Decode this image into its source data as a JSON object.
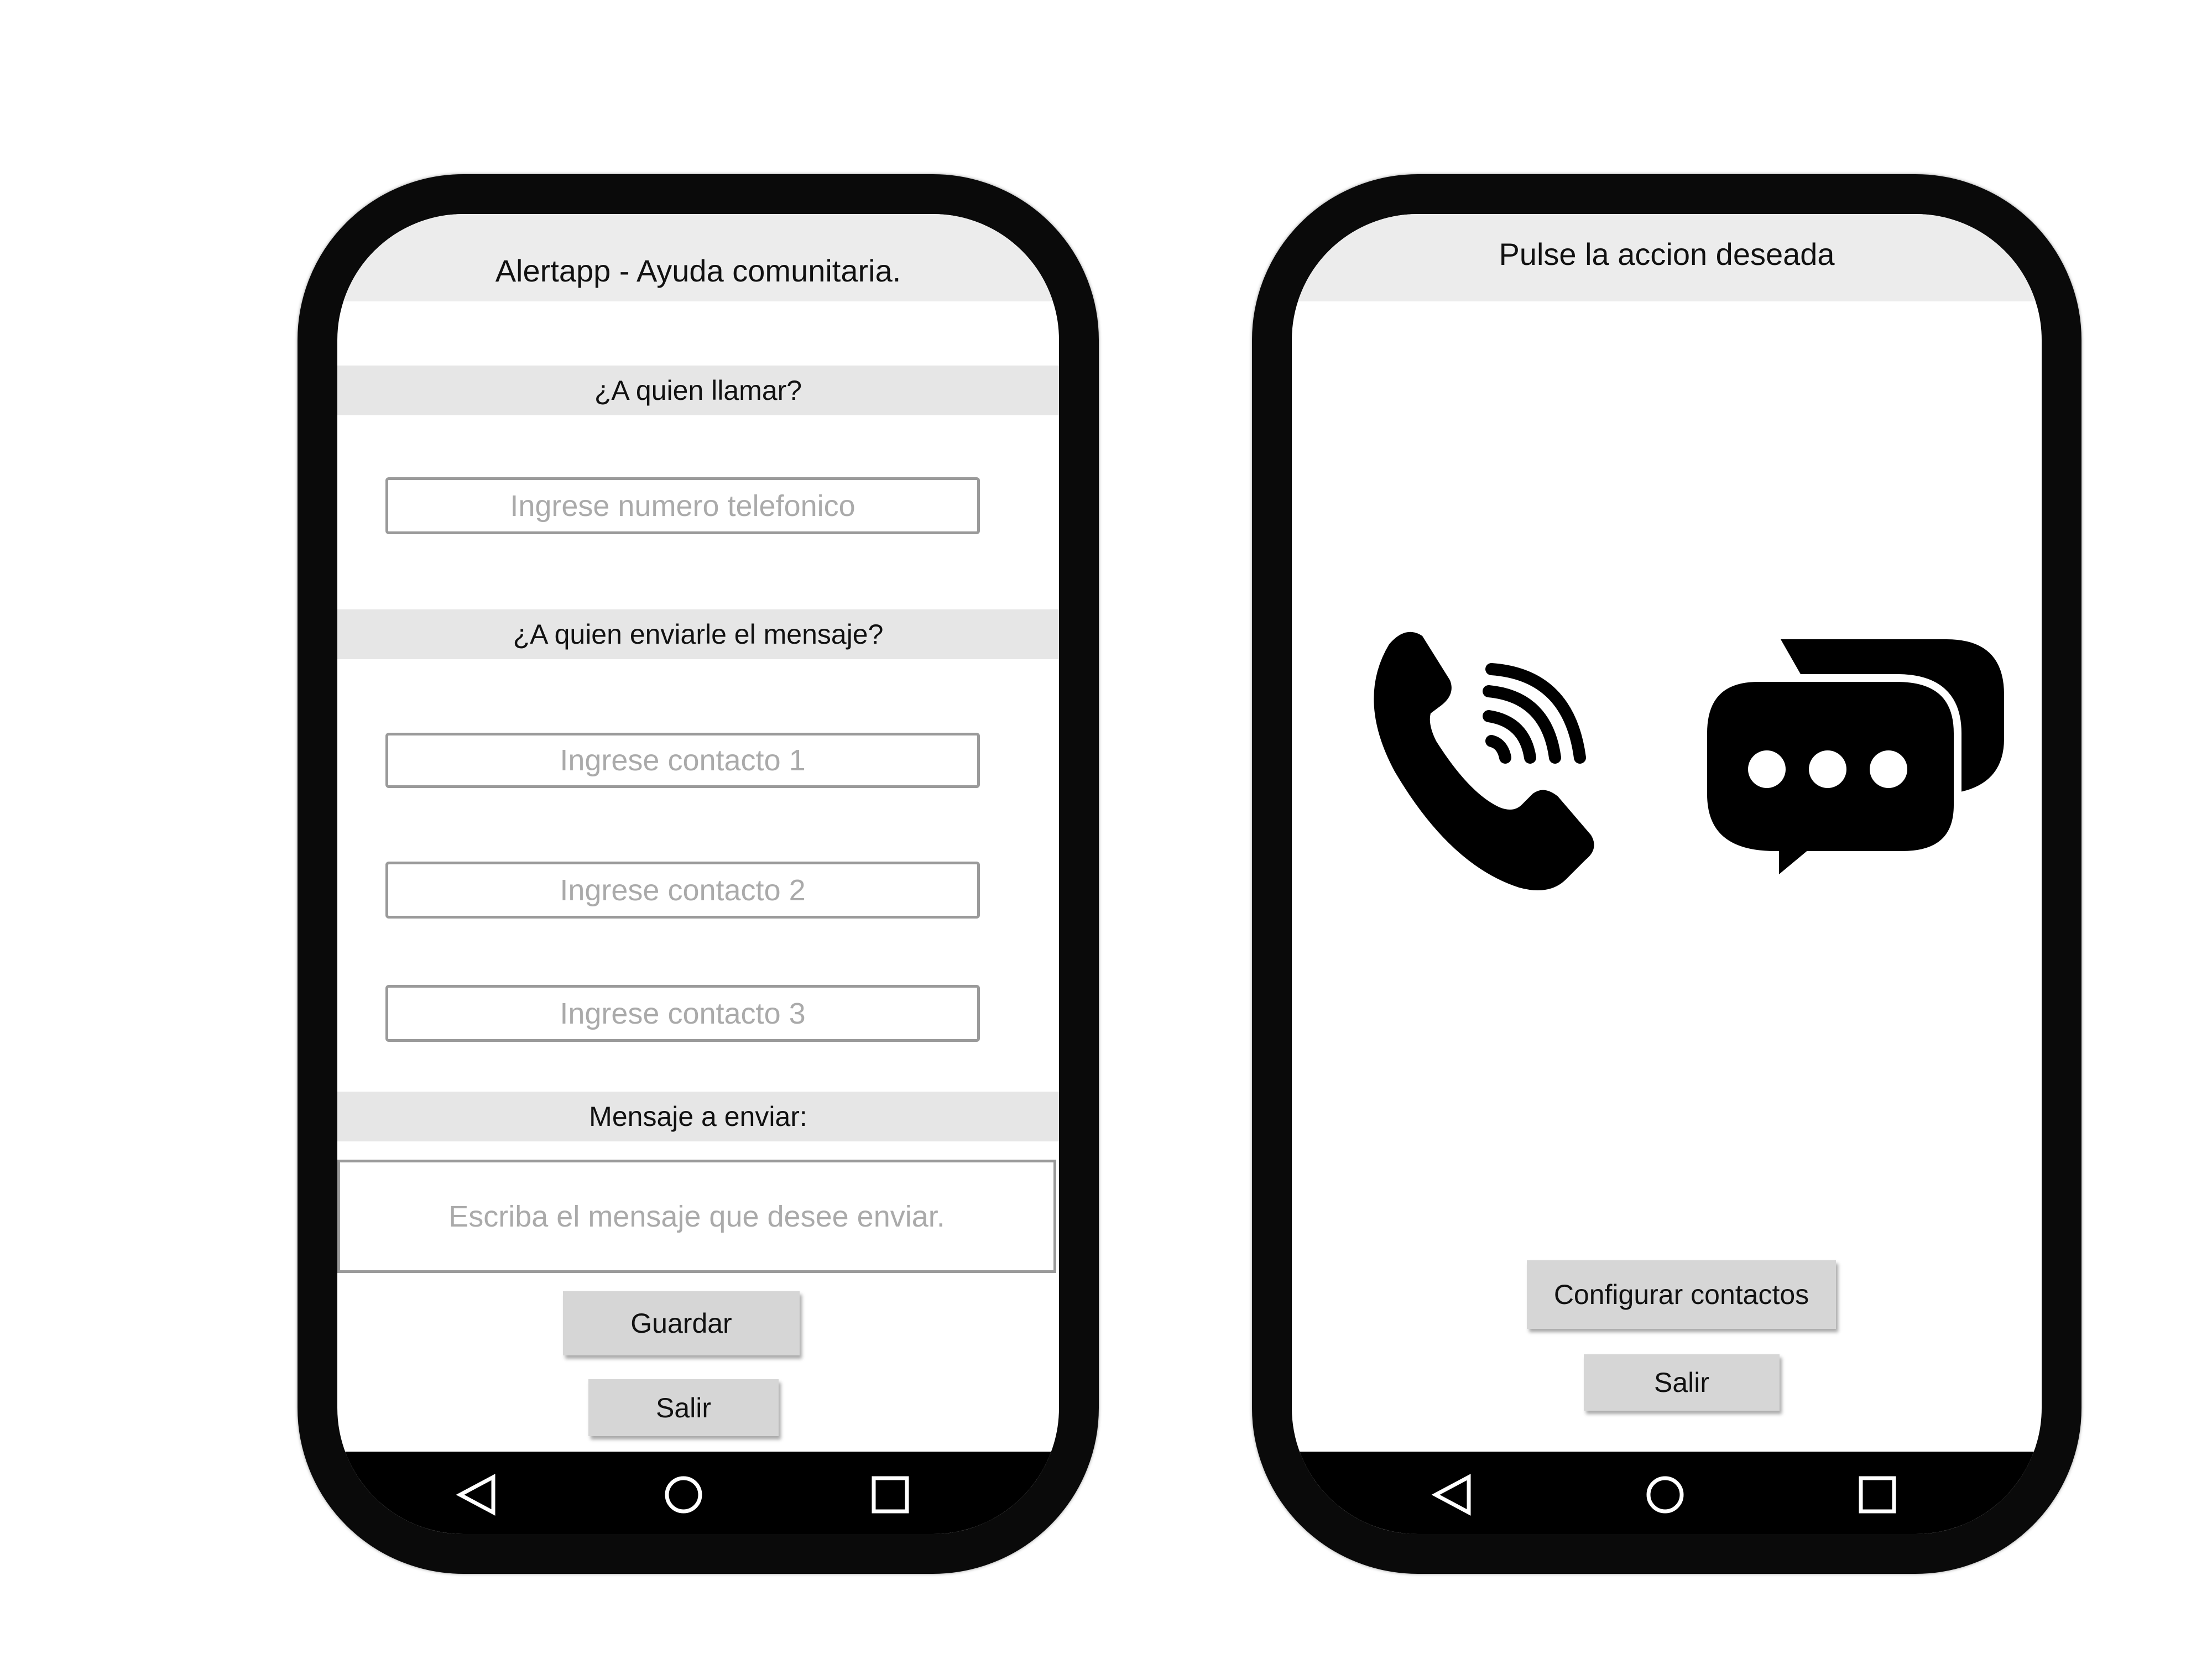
{
  "screen1": {
    "title": "Alertapp - Ayuda comunitaria.",
    "call_section": "¿A quien llamar?",
    "phone_placeholder": "Ingrese numero telefonico",
    "message_section": "¿A quien enviarle el mensaje?",
    "contact1_placeholder": "Ingrese contacto 1",
    "contact2_placeholder": "Ingrese contacto 2",
    "contact3_placeholder": "Ingrese contacto 3",
    "text_section": "Mensaje a enviar:",
    "message_placeholder": "Escriba el mensaje que desee enviar.",
    "save_label": "Guardar",
    "exit_label": "Salir"
  },
  "screen2": {
    "title": "Pulse la accion deseada",
    "configure_label": "Configurar contactos",
    "exit_label": "Salir",
    "icons": [
      "phone-call-icon",
      "chat-bubbles-icon"
    ]
  }
}
